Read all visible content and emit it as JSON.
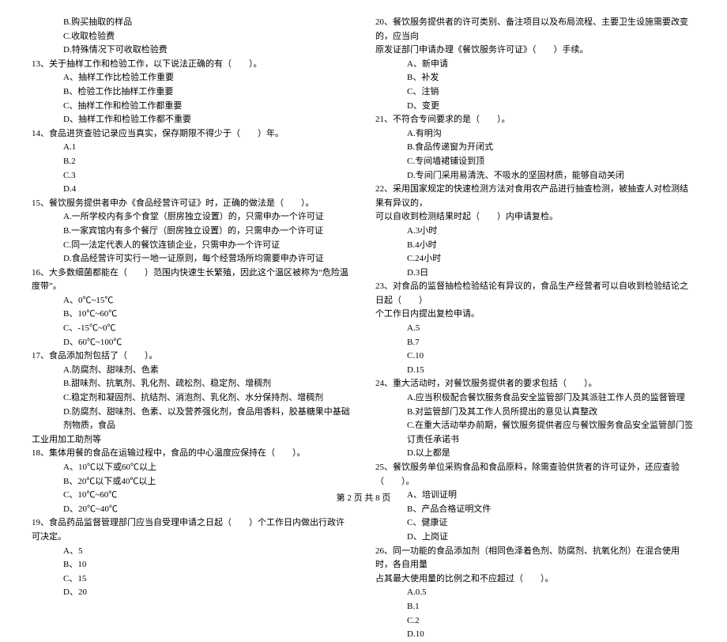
{
  "footer": "第 2 页 共 8 页",
  "left": [
    {
      "cls": "indent1",
      "text": "B.购买抽取的样品"
    },
    {
      "cls": "indent1",
      "text": "C.收取检验费"
    },
    {
      "cls": "indent1",
      "text": "D.特殊情况下可收取检验费"
    },
    {
      "cls": "indent0",
      "text": "13、关于抽样工作和检验工作，以下说法正确的有（　　）。"
    },
    {
      "cls": "indent1",
      "text": "A、抽样工作比检验工作重要"
    },
    {
      "cls": "indent1",
      "text": "B、检验工作比抽样工作重要"
    },
    {
      "cls": "indent1",
      "text": "C、抽样工作和检验工作都重要"
    },
    {
      "cls": "indent1",
      "text": "D、抽样工作和检验工作都不重要"
    },
    {
      "cls": "indent0",
      "text": "14、食品进货查验记录应当真实，保存期限不得少于（　　）年。"
    },
    {
      "cls": "indent1",
      "text": "A.1"
    },
    {
      "cls": "indent1",
      "text": "B.2"
    },
    {
      "cls": "indent1",
      "text": "C.3"
    },
    {
      "cls": "indent1",
      "text": "D.4"
    },
    {
      "cls": "indent0",
      "text": "15、餐饮服务提供者申办《食品经营许可证》时，正确的做法是（　　）。"
    },
    {
      "cls": "indent1",
      "text": "A.一所学校内有多个食堂（厨房独立设置）的，只需申办一个许可证"
    },
    {
      "cls": "indent1",
      "text": "B.一家宾馆内有多个餐厅（厨房独立设置）的，只需申办一个许可证"
    },
    {
      "cls": "indent1",
      "text": "C.同一法定代表人的餐饮连锁企业，只需申办一个许可证"
    },
    {
      "cls": "indent1",
      "text": "D.食品经营许可实行一地一证原则，每个经营场所均需要申办许可证"
    },
    {
      "cls": "indent0",
      "text": "16、大多数细菌都能在（　　）范围内快速生长繁殖，因此这个温区被称为“危险温度带”。"
    },
    {
      "cls": "indent1",
      "text": "A、0℃~15℃"
    },
    {
      "cls": "indent1",
      "text": "B、10℃~60℃"
    },
    {
      "cls": "indent1",
      "text": "C、-15℃~0℃"
    },
    {
      "cls": "indent1",
      "text": "D、60℃~100℃"
    },
    {
      "cls": "indent0",
      "text": "17、食品添加剂包括了（　　）。"
    },
    {
      "cls": "indent1",
      "text": "A.防腐剂、甜味剂、色素"
    },
    {
      "cls": "indent1",
      "text": "B.甜味剂、抗氧剂、乳化剂、疏松剂、稳定剂、增稠剂"
    },
    {
      "cls": "indent1",
      "text": "C.稳定剂和凝固剂、抗结剂、消泡剂、乳化剂、水分保持剂、增稠剂"
    },
    {
      "cls": "indent1",
      "text": "D.防腐剂、甜味剂、色素、以及营养强化剂，食品用香料，胶基糖果中基础剂物质，食品"
    },
    {
      "cls": "indent0",
      "text": "工业用加工助剂等"
    },
    {
      "cls": "indent0",
      "text": "18、集体用餐的食品在运输过程中，食品的中心温度应保持在（　　）。"
    },
    {
      "cls": "indent1",
      "text": "A、10℃以下或60℃以上"
    },
    {
      "cls": "indent1",
      "text": "B、20℃以下或40℃以上"
    },
    {
      "cls": "indent1",
      "text": "C、10℃~60℃"
    },
    {
      "cls": "indent1",
      "text": "D、20℃~40℃"
    },
    {
      "cls": "indent0",
      "text": "19、食品药品监督管理部门应当自受理申请之日起（　　）个工作日内做出行政许可决定。"
    },
    {
      "cls": "indent1",
      "text": "A、5"
    },
    {
      "cls": "indent1",
      "text": "B、10"
    },
    {
      "cls": "indent1",
      "text": "C、15"
    },
    {
      "cls": "indent1",
      "text": "D、20"
    }
  ],
  "right": [
    {
      "cls": "indent0",
      "text": "20、餐饮服务提供者的许可类别、备注项目以及布局流程、主要卫生设施需要改变的，应当向"
    },
    {
      "cls": "indent0",
      "text": "原发证部门申请办理《餐饮服务许可证》（　　）手续。"
    },
    {
      "cls": "indent1",
      "text": "A、新申请"
    },
    {
      "cls": "indent1",
      "text": "B、补发"
    },
    {
      "cls": "indent1",
      "text": "C、注销"
    },
    {
      "cls": "indent1",
      "text": "D、变更"
    },
    {
      "cls": "indent0",
      "text": "21、不符合专间要求的是（　　）。"
    },
    {
      "cls": "indent1",
      "text": "A.有明沟"
    },
    {
      "cls": "indent1",
      "text": "B.食品传递窗为开闭式"
    },
    {
      "cls": "indent1",
      "text": "C.专间墙裙铺设到顶"
    },
    {
      "cls": "indent1",
      "text": "D.专间门采用易清洗、不吸水的坚固材质，能够自动关闭"
    },
    {
      "cls": "indent0",
      "text": "22、采用国家规定的快速检测方法对食用农产品进行抽查检测，被抽查人对检测结果有异议的，"
    },
    {
      "cls": "indent0",
      "text": "可以自收到检测结果时起（　　）内申请复检。"
    },
    {
      "cls": "indent1",
      "text": "A.3小时"
    },
    {
      "cls": "indent1",
      "text": "B.4小时"
    },
    {
      "cls": "indent1",
      "text": "C.24小时"
    },
    {
      "cls": "indent1",
      "text": "D.3日"
    },
    {
      "cls": "indent0",
      "text": "23、对食品的监督抽检检验结论有异议的，食品生产经营者可以自收到检验结论之日起（　　）"
    },
    {
      "cls": "indent0",
      "text": "个工作日内提出复检申请。"
    },
    {
      "cls": "indent1",
      "text": "A.5"
    },
    {
      "cls": "indent1",
      "text": "B.7"
    },
    {
      "cls": "indent1",
      "text": "C.10"
    },
    {
      "cls": "indent1",
      "text": "D.15"
    },
    {
      "cls": "indent0",
      "text": "24、重大活动时，对餐饮服务提供者的要求包括（　　）。"
    },
    {
      "cls": "indent1",
      "text": "A.应当积极配合餐饮服务食品安全监管部门及其派驻工作人员的监督管理"
    },
    {
      "cls": "indent1",
      "text": "B.对监管部门及其工作人员所提出的意见认真整改"
    },
    {
      "cls": "indent1",
      "text": "C.在重大活动举办前期，餐饮服务提供者应与餐饮服务食品安全监管部门签订责任承诺书"
    },
    {
      "cls": "indent1",
      "text": "D.以上都是"
    },
    {
      "cls": "indent0",
      "text": "25、餐饮服务单位采购食品和食品原料，除需查验供货者的许可证外，还应查验（　　）。"
    },
    {
      "cls": "indent1",
      "text": "A、培训证明"
    },
    {
      "cls": "indent1",
      "text": "B、产品合格证明文件"
    },
    {
      "cls": "indent1",
      "text": "C、健康证"
    },
    {
      "cls": "indent1",
      "text": "D、上岗证"
    },
    {
      "cls": "indent0",
      "text": "26、同一功能的食品添加剂（相同色泽着色剂、防腐剂、抗氧化剂）在混合使用时，各自用量"
    },
    {
      "cls": "indent0",
      "text": "占其最大使用量的比例之和不应超过（　　）。"
    },
    {
      "cls": "indent1",
      "text": "A.0.5"
    },
    {
      "cls": "indent1",
      "text": "B.1"
    },
    {
      "cls": "indent1",
      "text": "C.2"
    },
    {
      "cls": "indent1",
      "text": "D.10"
    }
  ]
}
